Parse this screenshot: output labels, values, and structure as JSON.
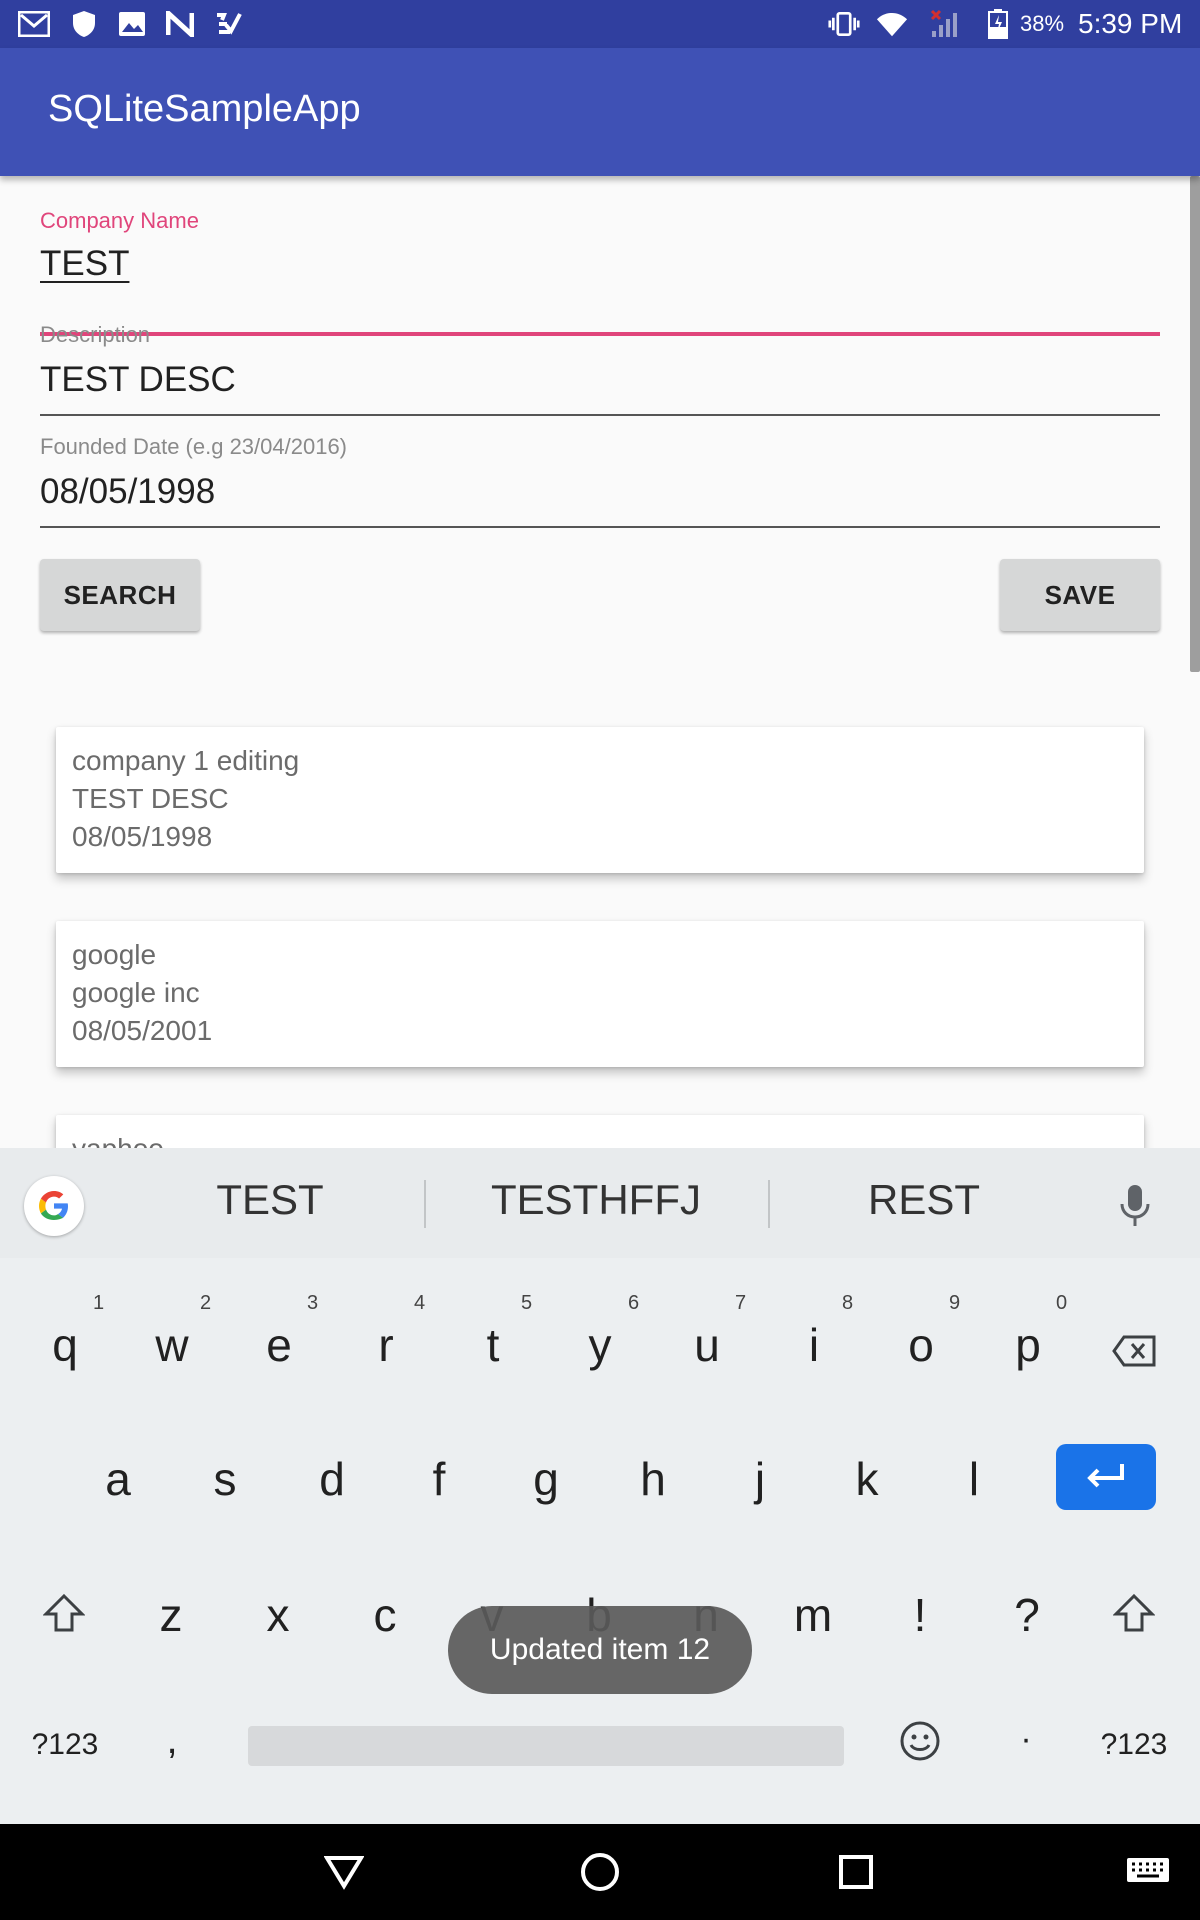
{
  "status_bar": {
    "battery": "38%",
    "time": "5:39 PM",
    "left_icons": [
      "gmail-icon",
      "shield-icon",
      "image-icon",
      "n-icon",
      "tasks-icon"
    ],
    "right_icons": [
      "vibrate-icon",
      "wifi-icon",
      "signal-icon",
      "battery-icon"
    ]
  },
  "app_bar": {
    "title": "SQLiteSampleApp",
    "color": "#3f51b5"
  },
  "form": {
    "company_name": {
      "label": "Company Name",
      "value": "TEST"
    },
    "description": {
      "label": "Description",
      "value": "TEST DESC"
    },
    "founded_date": {
      "label": "Founded Date (e.g 23/04/2016)",
      "value": "08/05/1998"
    },
    "search_label": "SEARCH",
    "save_label": "SAVE"
  },
  "companies": [
    {
      "name": "company 1 editing",
      "description": "TEST DESC",
      "date": "08/05/1998"
    },
    {
      "name": "google",
      "description": "google inc",
      "date": "08/05/2001"
    },
    {
      "name": "yaphoo"
    }
  ],
  "keyboard": {
    "suggestions": [
      "TEST",
      "TESTHFFJ",
      "REST"
    ],
    "row1": [
      "q",
      "w",
      "e",
      "r",
      "t",
      "y",
      "u",
      "i",
      "o",
      "p"
    ],
    "row1_hints": [
      "1",
      "2",
      "3",
      "4",
      "5",
      "6",
      "7",
      "8",
      "9",
      "0"
    ],
    "row2": [
      "a",
      "s",
      "d",
      "f",
      "g",
      "h",
      "j",
      "k",
      "l"
    ],
    "row3": [
      "z",
      "x",
      "c",
      "v",
      "b",
      "n",
      "m",
      "!",
      "?"
    ],
    "symbols_label": "?123",
    "comma": ",",
    "period": "·",
    "enter_color": "#1a73e8"
  },
  "toast": {
    "message": "Updated item 12"
  },
  "accent_color": "#e0457b"
}
